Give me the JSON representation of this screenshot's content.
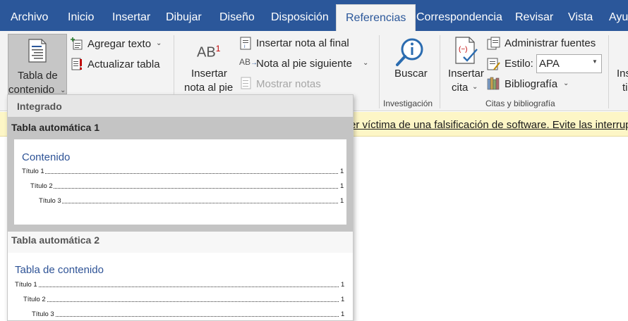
{
  "tabs": [
    "Archivo",
    "Inicio",
    "Insertar",
    "Dibujar",
    "Diseño",
    "Disposición",
    "Referencias",
    "Correspondencia",
    "Revisar",
    "Vista",
    "Ayuda"
  ],
  "ribbon": {
    "toc": {
      "label1": "Tabla de",
      "label2": "contenido"
    },
    "agregar_texto": "Agregar texto",
    "actualizar_tabla": "Actualizar tabla",
    "insertar_nota_pie": {
      "label1": "Insertar",
      "label2": "nota al pie"
    },
    "insertar_nota_final": "Insertar nota al final",
    "nota_pie_siguiente": "Nota al pie siguiente",
    "mostrar_notas": "Mostrar notas",
    "buscar": "Buscar",
    "group_investigacion": "Investigación",
    "insertar_cita": {
      "label1": "Insertar",
      "label2": "cita"
    },
    "administrar_fuentes": "Administrar fuentes",
    "estilo_label": "Estilo:",
    "estilo_value": "APA",
    "bibliografia": "Bibliografía",
    "group_citas": "Citas y bibliografía",
    "insertar_partial": {
      "label1": "Ins",
      "label2": "ti"
    }
  },
  "notification": {
    "text": "er víctima de una falsificación de software. Evite las interrup"
  },
  "dropdown": {
    "header": "Integrado",
    "items": [
      {
        "name": "Tabla automática 1",
        "preview_title": "Contenido",
        "rows": [
          {
            "label": "Título 1",
            "page": "1"
          },
          {
            "label": "Título 2",
            "page": "1"
          },
          {
            "label": "Título 3",
            "page": "1"
          }
        ]
      },
      {
        "name": "Tabla automática 2",
        "preview_title": "Tabla de contenido",
        "rows": [
          {
            "label": "Título 1",
            "page": "1"
          },
          {
            "label": "Título 2",
            "page": "1"
          },
          {
            "label": "Título 3",
            "page": "1"
          }
        ]
      }
    ]
  },
  "colors": {
    "title_bar": "#2b579a",
    "ribbon_bg": "#f3f3f3",
    "notification_bg": "#fdf6c6",
    "preview_heading": "#2e5396",
    "selected_item": "#c4c4c4"
  }
}
